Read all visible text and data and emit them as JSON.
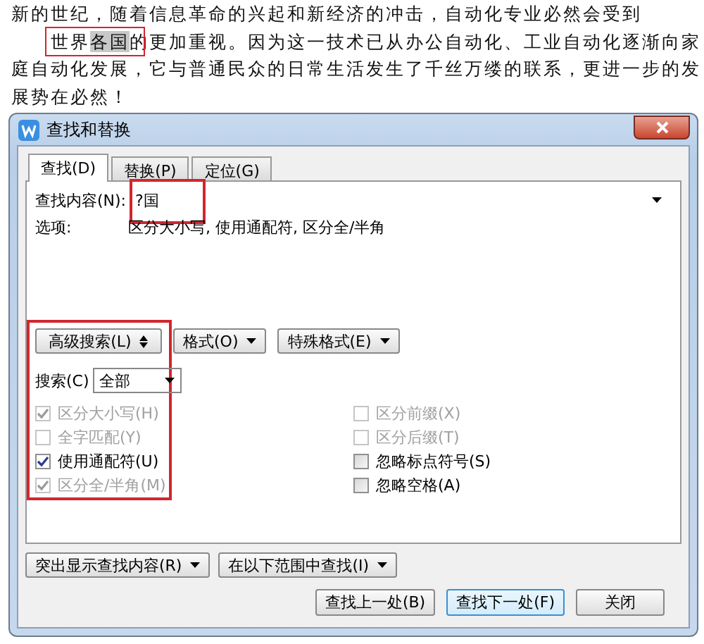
{
  "document": {
    "lines": [
      {
        "text": "新的世纪，随着信息革命的兴起和新经济的冲击，自动化专业必然会受到",
        "indent": false
      },
      {
        "text": "世界**各国**的更加重视。因为这一技术已从办公自动化、工业自动化逐渐向家",
        "indent": true
      },
      {
        "text": "庭自动化发展，它与普通民众的日常生活发生了千丝万缕的联系，更进一步的发",
        "indent": false
      },
      {
        "text": "展势在必然！",
        "indent": false
      }
    ]
  },
  "dialog": {
    "title": "查找和替换",
    "tabs": [
      {
        "label": "查找(D)",
        "selected": true
      },
      {
        "label": "替换(P)",
        "selected": false
      },
      {
        "label": "定位(G)",
        "selected": false
      }
    ],
    "find_label": "查找内容(N):",
    "find_value": "?国",
    "options_label": "选项:",
    "options_value": "区分大小写, 使用通配符, 区分全/半角",
    "advanced_buttons": [
      "高级搜索(L)",
      "格式(O)",
      "特殊格式(E)"
    ],
    "search_label": "搜索(C)",
    "search_value": "全部",
    "checkboxes_left": [
      {
        "label": "区分大小写(H)",
        "checked": true,
        "disabled": true
      },
      {
        "label": "全字匹配(Y)",
        "checked": false,
        "disabled": true
      },
      {
        "label": "使用通配符(U)",
        "checked": true,
        "disabled": false
      },
      {
        "label": "区分全/半角(M)",
        "checked": true,
        "disabled": true
      }
    ],
    "checkboxes_right": [
      {
        "label": "区分前缀(X)",
        "checked": false,
        "disabled": true
      },
      {
        "label": "区分后缀(T)",
        "checked": false,
        "disabled": true
      },
      {
        "label": "忽略标点符号(S)",
        "checked": false,
        "disabled": false
      },
      {
        "label": "忽略空格(A)",
        "checked": false,
        "disabled": false
      }
    ],
    "lower_buttons": [
      "突出显示查找内容(R)",
      "在以下范围中查找(I)"
    ],
    "action_buttons": [
      {
        "label": "查找上一处(B)",
        "focused": false
      },
      {
        "label": "查找下一处(F)",
        "focused": true
      },
      {
        "label": "关闭",
        "focused": false
      }
    ]
  }
}
